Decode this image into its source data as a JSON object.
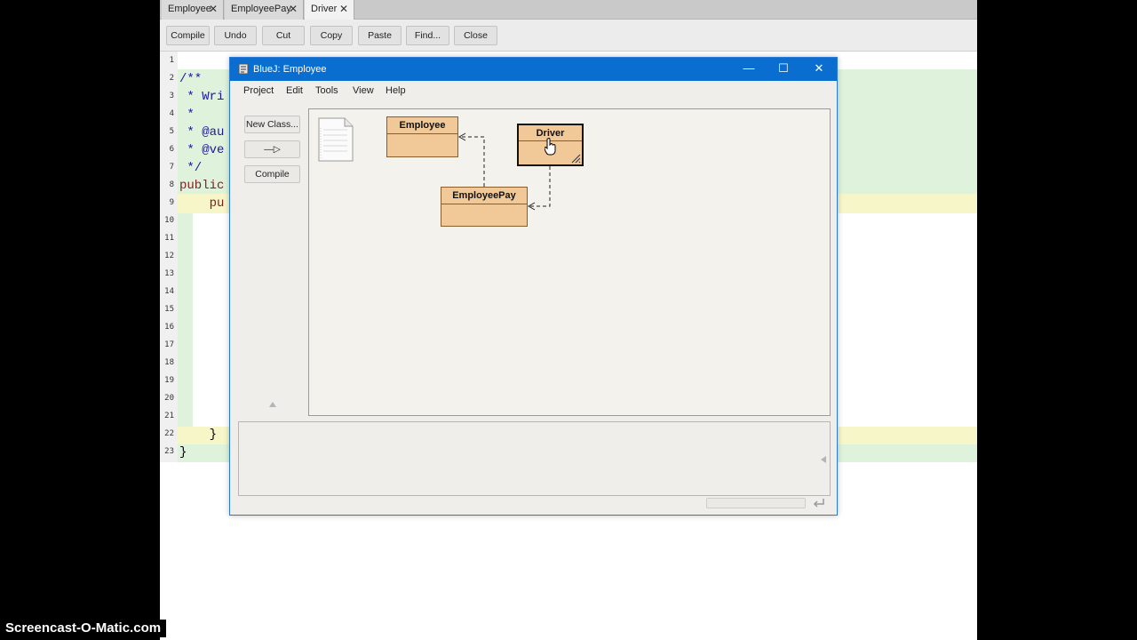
{
  "editor": {
    "tabs": [
      {
        "label": "Employee",
        "close": "✕"
      },
      {
        "label": "EmployeePay",
        "close": "✕"
      },
      {
        "label": "Driver",
        "close": "✕"
      }
    ],
    "toolbar": [
      "Compile",
      "Undo",
      "Cut",
      "Copy",
      "Paste",
      "Find...",
      "Close"
    ],
    "line_numbers": [
      "1",
      "2",
      "3",
      "4",
      "5",
      "6",
      "7",
      "8",
      "9",
      "10",
      "11",
      "12",
      "13",
      "14",
      "15",
      "16",
      "17",
      "18",
      "19",
      "20",
      "21",
      "22",
      "23"
    ],
    "code_lines": [
      {
        "text": "/**"
      },
      {
        "text": " * Wri"
      },
      {
        "text": " *"
      },
      {
        "text": " * @au"
      },
      {
        "text": " * @ve"
      },
      {
        "text": " */"
      },
      {
        "text": "public"
      },
      {
        "text": "    pu"
      },
      {
        "text": "    }"
      },
      {
        "text": "}"
      }
    ]
  },
  "bluej": {
    "title": "BlueJ:  Employee",
    "window_controls": {
      "minimize": "—",
      "maximize": "☐",
      "close": "✕"
    },
    "menu": [
      "Project",
      "Edit",
      "Tools",
      "View",
      "Help"
    ],
    "side_buttons": {
      "new_class": "New Class...",
      "arrow": "—▷",
      "compile": "Compile"
    },
    "classes": [
      {
        "name": "Employee"
      },
      {
        "name": "Driver"
      },
      {
        "name": "EmployeePay"
      }
    ]
  },
  "watermark": "Screencast-O-Matic.com"
}
